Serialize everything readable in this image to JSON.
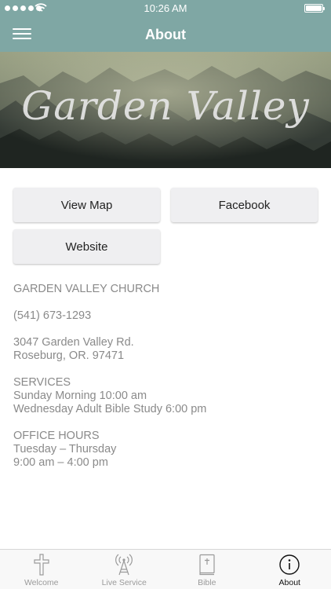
{
  "status_bar": {
    "time": "10:26 AM"
  },
  "nav": {
    "title": "About"
  },
  "hero": {
    "logo_text": "Garden Valley"
  },
  "buttons": {
    "view_map": "View Map",
    "facebook": "Facebook",
    "website": "Website"
  },
  "info": {
    "church_name": "GARDEN VALLEY CHURCH",
    "phone": "(541) 673-1293",
    "address_line1": "3047 Garden Valley Rd.",
    "address_line2": "Roseburg, OR. 97471",
    "services_heading": "SERVICES",
    "service1": "Sunday Morning 10:00 am",
    "service2": "Wednesday Adult Bible Study 6:00 pm",
    "office_heading": "OFFICE HOURS",
    "office_days": "Tuesday – Thursday",
    "office_time": "9:00 am – 4:00 pm"
  },
  "tabs": [
    {
      "label": "Welcome",
      "icon": "cross-icon"
    },
    {
      "label": "Live Service",
      "icon": "broadcast-tower-icon"
    },
    {
      "label": "Bible",
      "icon": "bible-icon"
    },
    {
      "label": "About",
      "icon": "info-icon"
    }
  ],
  "colors": {
    "accent": "#7fa7a4",
    "text_muted": "#8a8a8a",
    "button_bg": "#efeff1"
  }
}
